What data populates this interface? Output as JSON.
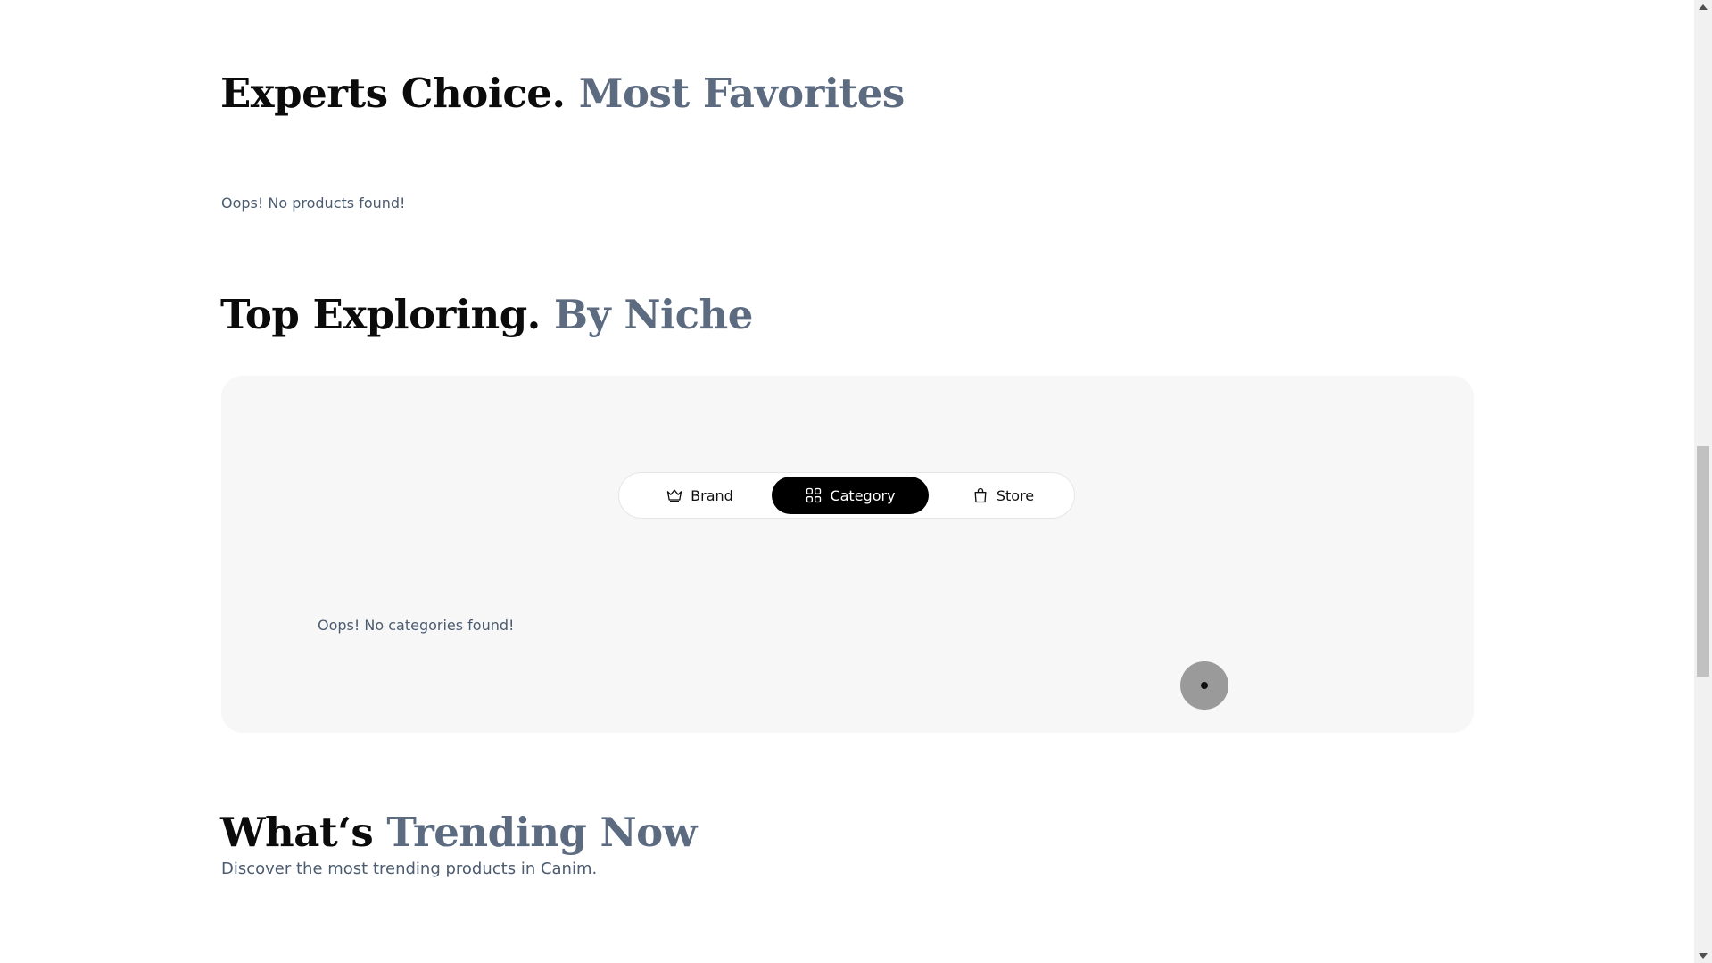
{
  "sections": {
    "experts": {
      "title": "Experts Choice.",
      "accent": "Most Favorites",
      "empty_text": "Oops! No products found!"
    },
    "niche": {
      "title": "Top Exploring.",
      "accent": "By Niche",
      "tabs": [
        {
          "label": "Brand",
          "icon": "crown-icon",
          "active": false
        },
        {
          "label": "Category",
          "icon": "grid-icon",
          "active": true
        },
        {
          "label": "Store",
          "icon": "shopping-bag-icon",
          "active": false
        }
      ],
      "empty_text": "Oops! No categories found!"
    },
    "trending": {
      "title": "What‘s",
      "accent": "Trending Now",
      "subtitle": "Discover the most trending products in Canim."
    }
  },
  "colors": {
    "heading": "#0b0b0b",
    "accent": "#5c6b80",
    "panel_bg": "#f7f7f7",
    "active_tab_bg": "#000000"
  }
}
